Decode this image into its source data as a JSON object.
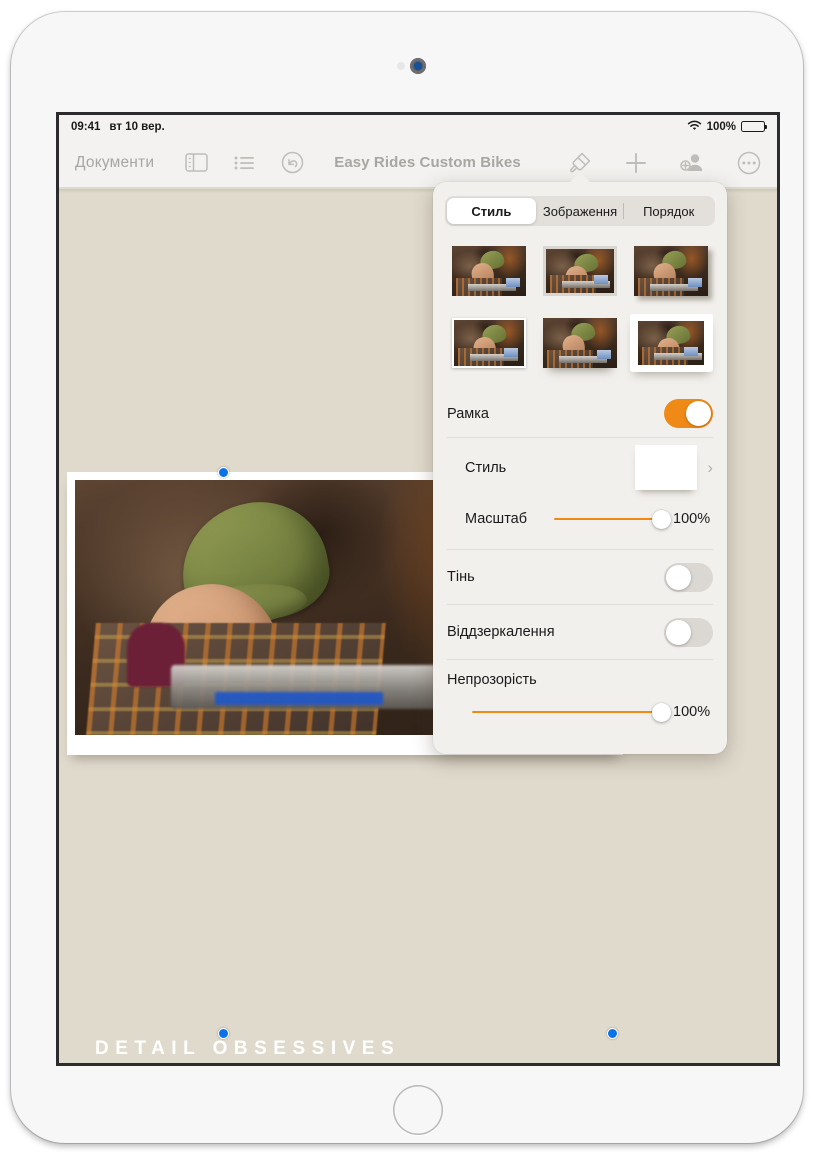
{
  "status_bar": {
    "time": "09:41",
    "date": "вт 10 вер.",
    "wifi_icon": "wifi-icon",
    "battery_percent": "100%",
    "battery_icon": "battery-full-icon"
  },
  "toolbar": {
    "documents_label": "Документи",
    "sidebar_icon": "sidebar-icon",
    "list_icon": "bullet-list-icon",
    "undo_icon": "undo-icon",
    "document_title": "Easy Rides Custom Bikes",
    "format_icon": "paintbrush-icon",
    "insert_icon": "plus-icon",
    "collaborate_icon": "add-person-icon",
    "more_icon": "more-ellipsis-icon"
  },
  "document": {
    "headline": "DETAIL OBSESSIVES",
    "background_color": "#e0dacd",
    "image_alt": "Man in olive beanie working in a bike workshop"
  },
  "popover": {
    "tabs": [
      {
        "label": "Стиль",
        "selected": true
      },
      {
        "label": "Зображення",
        "selected": false
      },
      {
        "label": "Порядок",
        "selected": false
      }
    ],
    "style_thumbnails": [
      {
        "name": "style-plain",
        "selected": false
      },
      {
        "name": "style-gray-border",
        "selected": false
      },
      {
        "name": "style-drop-shadow",
        "selected": false
      },
      {
        "name": "style-white-border",
        "selected": false
      },
      {
        "name": "style-soft-shadow",
        "selected": false
      },
      {
        "name": "style-white-frame-shadow",
        "selected": true
      }
    ],
    "rows": {
      "border": {
        "label": "Рамка",
        "toggle_on": true
      },
      "border_style": {
        "label": "Стиль",
        "swatch_color": "#a7cde8",
        "chevron": "›"
      },
      "scale": {
        "label": "Масштаб",
        "value": "100%",
        "fill_percent": 100
      },
      "shadow": {
        "label": "Тінь",
        "toggle_on": false
      },
      "reflection": {
        "label": "Віддзеркалення",
        "toggle_on": false
      },
      "opacity": {
        "label": "Непрозорість",
        "value": "100%",
        "fill_percent": 100
      }
    },
    "accent_color": "#f08a16"
  }
}
